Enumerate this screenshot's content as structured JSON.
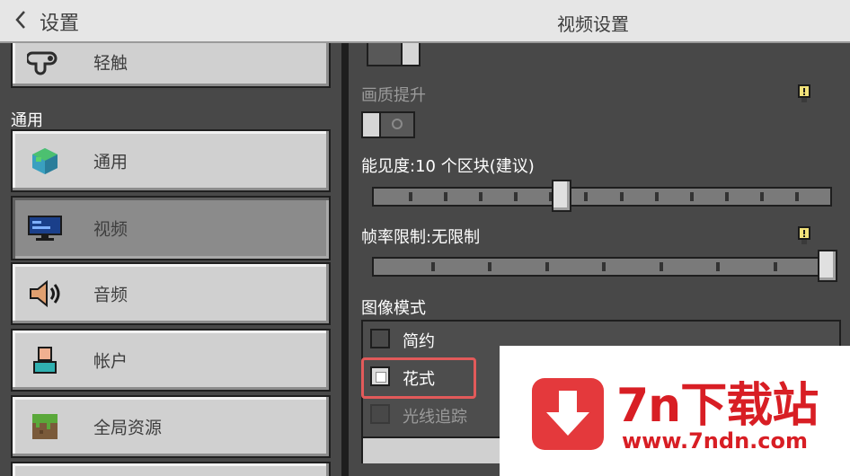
{
  "header": {
    "back_label": "设置",
    "title": "视频设置"
  },
  "sidebar": {
    "partial_item": {
      "label": "轻触",
      "icon": "touch-hand-icon"
    },
    "section_label": "通用",
    "items": [
      {
        "label": "通用",
        "icon": "globe-cube-icon",
        "selected": false
      },
      {
        "label": "视频",
        "icon": "monitor-icon",
        "selected": true
      },
      {
        "label": "音频",
        "icon": "speaker-icon",
        "selected": false
      },
      {
        "label": "帐户",
        "icon": "account-icon",
        "selected": false
      },
      {
        "label": "全局资源",
        "icon": "grass-block-icon",
        "selected": false
      }
    ]
  },
  "settings": {
    "quality_upgrade": {
      "label": "画质提升",
      "enabled": false,
      "disabled_label": true
    },
    "render_distance": {
      "label": "能见度:10 个区块(建议)",
      "ticks": 12
    },
    "framerate": {
      "label": "帧率限制:无限制",
      "ticks": 7
    },
    "graphics_mode": {
      "label": "图像模式",
      "options": [
        {
          "label": "简约",
          "checked": false,
          "disabled": false
        },
        {
          "label": "花式",
          "checked": true,
          "disabled": false
        },
        {
          "label": "光线追踪",
          "checked": false,
          "disabled": true
        }
      ]
    }
  },
  "watermark": {
    "brand": "7n下载站",
    "url": "www.7ndn.com"
  },
  "colors": {
    "accent_highlight": "#e25a5a",
    "brand_red": "#d81e24"
  }
}
